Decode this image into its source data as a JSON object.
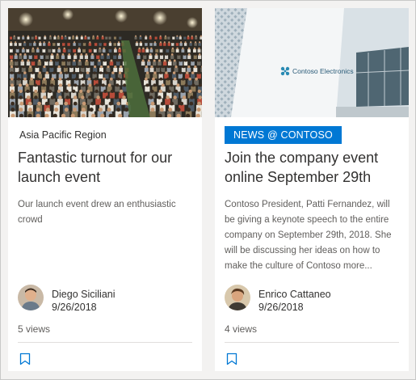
{
  "cards": [
    {
      "topic": "Asia Pacific Region",
      "title": "Fantastic turnout for our launch event",
      "description": "Our launch event drew an enthusiastic crowd",
      "author": "Diego Siciliani",
      "date": "9/26/2018",
      "views": "5 views",
      "image": "conference-audience-photo",
      "avatar": "diego-avatar"
    },
    {
      "badge": "NEWS @ CONTOSO",
      "logo_text": "Contoso Electronics",
      "title": "Join the company event online September 29th",
      "description": "Contoso President, Patti Fernandez, will be giving a keynote speech to the entire company on September 29th, 2018. She will be discussing her ideas on how to make the culture of Contoso more...",
      "author": "Enrico Cattaneo",
      "date": "9/26/2018",
      "views": "4 views",
      "image": "contoso-building-photo",
      "avatar": "enrico-avatar"
    }
  ],
  "colors": {
    "accent": "#0078d4",
    "page_background": "#f3f2f1",
    "title_text": "#323130",
    "secondary_text": "#605e5c"
  },
  "icons": [
    "bookmark-icon",
    "contoso-logo-icon"
  ]
}
